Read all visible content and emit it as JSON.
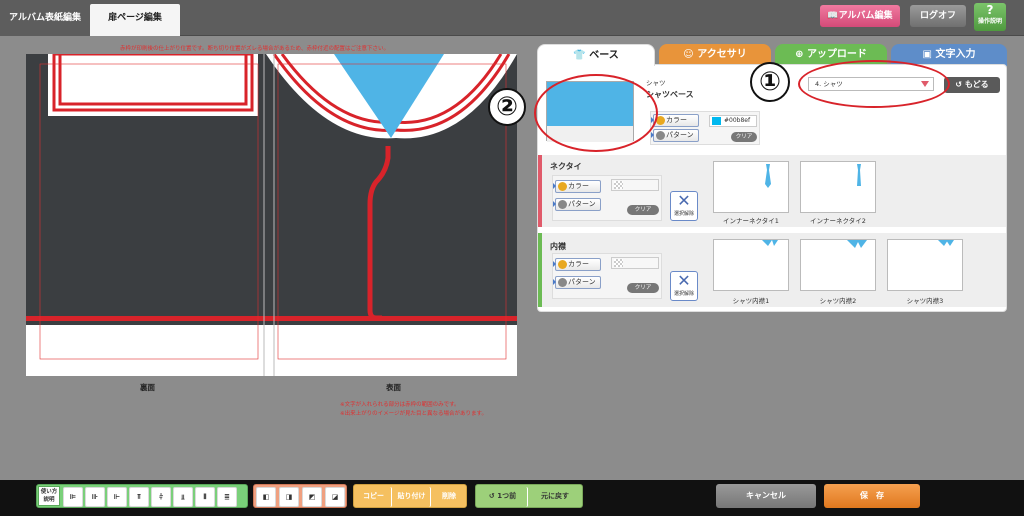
{
  "topbar": {
    "tabs": [
      "アルバム表紙編集",
      "扉ページ編集"
    ],
    "album_button": "アルバム編集",
    "logoff_button": "ログオフ",
    "help_button": "操作説明",
    "help_glyph": "?"
  },
  "notice_top": "赤枠が印刷後の仕上がり位置です。断ち切り位置がズレる場合があるため、赤枠付近の配置はご注意下さい。",
  "canvas": {
    "back_label": "裏面",
    "front_label": "表面",
    "notes": [
      "※文字が入れられる部分は赤枠の範囲のみです。",
      "※出来上がりのイメージが見た目と異なる場合があります。"
    ],
    "colors": {
      "dark": "#3b3e41",
      "red": "#d8232a",
      "blue": "#4fb4e6",
      "white": "#ffffff"
    }
  },
  "panel": {
    "tabs": [
      "ベース",
      "アクセサリ",
      "アップロード",
      "文字入力"
    ],
    "tab_icons": [
      "shirt-icon",
      "smile-icon",
      "upload-icon",
      "text-icon"
    ],
    "tab_colors": [
      "#ffffff",
      "#e8943a",
      "#6cbb54",
      "#5e8dc9"
    ],
    "select_value": "4. シャツ",
    "back_button": "もどる",
    "shirt": {
      "small_label": "シャツ",
      "title": "シャツベース",
      "color_button": "カラー",
      "pattern_button": "パターン",
      "color_value": "#00b8ef",
      "clear_button": "クリア"
    },
    "necktie": {
      "title": "ネクタイ",
      "color_button": "カラー",
      "pattern_button": "パターン",
      "clear_button": "クリア",
      "unset_label": "選択解除",
      "options": [
        "インナーネクタイ1",
        "インナーネクタイ2"
      ]
    },
    "collar": {
      "title": "内襟",
      "color_button": "カラー",
      "pattern_button": "パターン",
      "clear_button": "クリア",
      "unset_label": "選択解除",
      "options": [
        "シャツ内襟1",
        "シャツ内襟2",
        "シャツ内襟3"
      ]
    }
  },
  "annotations": {
    "one": "①",
    "two": "②"
  },
  "bottombar": {
    "howto": "使い方説明",
    "edit_buttons": [
      "コピー",
      "貼り付け",
      "削除"
    ],
    "history_buttons": [
      "1つ前",
      "元に戻す"
    ],
    "cancel": "キャンセル",
    "save": "保　存"
  }
}
